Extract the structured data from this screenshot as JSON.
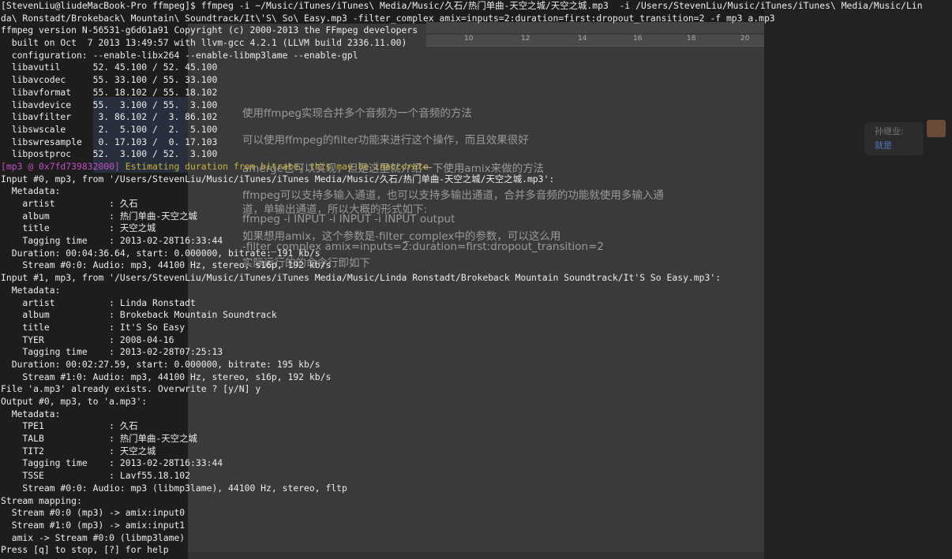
{
  "background_doc": {
    "ruler_ticks": [
      "10",
      "12",
      "14",
      "16",
      "18",
      "20"
    ],
    "lines": [
      "使用ffmpeg实现合并多个音频为一个音频的方法",
      "可以使用ffmpeg的filter功能来进行这个操作，而且效果很好",
      "amerge也可以实现，但是这里就介绍一下使用amix来做的方法",
      "ffmpeg可以支持多输入通道，也可以支持多输出通道，合并多音频的功能就使用多输入通",
      "道，单输出通道，所以大概的形式如下:",
      "ffmpeg -i INPUT -i INPUT -i INPUT output",
      "如果想用amix，这个参数是-filter_complex中的参数，可以这么用",
      "-filter_complex amix=inputs=2:duration=first:dropout_transition=2",
      "实际运行的的命令行即如下"
    ],
    "chat_name": "孙继业:",
    "chat_link": "就是"
  },
  "terminal": {
    "lines": [
      "[StevenLiu@liudeMacBook-Pro ffmpeg]$ ffmpeg -i ~/Music/iTunes/iTunes\\ Media/Music/久石/热门单曲-天空之城/天空之城.mp3  -i /Users/StevenLiu/Music/iTunes/iTunes\\ Media/Music/Lin",
      "da\\ Ronstadt/Brokeback\\ Mountain\\ Soundtrack/It\\'S\\ So\\ Easy.mp3 -filter_complex amix=inputs=2:duration=first:dropout_transition=2 -f mp3 a.mp3",
      "ffmpeg version N-56531-g6d61a91 Copyright (c) 2000-2013 the FFmpeg developers",
      "  built on Oct  7 2013 13:49:57 with llvm-gcc 4.2.1 (LLVM build 2336.11.00)",
      "  configuration: --enable-libx264 --enable-libmp3lame --enable-gpl",
      "  libavutil      52. 45.100 / 52. 45.100",
      "  libavcodec     55. 33.100 / 55. 33.100",
      "  libavformat    55. 18.102 / 55. 18.102",
      "  libavdevice    55.  3.100 / 55.  3.100",
      "  libavfilter     3. 86.102 /  3. 86.102",
      "  libswscale      2.  5.100 /  2.  5.100",
      "  libswresample   0. 17.103 /  0. 17.103",
      "  libpostproc    52.  3.100 / 52.  3.100",
      "",
      "Input #0, mp3, from '/Users/StevenLiu/Music/iTunes/iTunes Media/Music/久石/热门单曲-天空之城/天空之城.mp3':",
      "  Metadata:",
      "    artist          : 久石",
      "    album           : 热门单曲-天空之城",
      "    title           : 天空之城",
      "    Tagging time    : 2013-02-28T16:33:44",
      "  Duration: 00:04:36.64, start: 0.000000, bitrate: 191 kb/s",
      "    Stream #0:0: Audio: mp3, 44100 Hz, stereo, s16p, 192 kb/s",
      "Input #1, mp3, from '/Users/StevenLiu/Music/iTunes/iTunes Media/Music/Linda Ronstadt/Brokeback Mountain Soundtrack/It'S So Easy.mp3':",
      "  Metadata:",
      "    artist          : Linda Ronstadt",
      "    album           : Brokeback Mountain Soundtrack",
      "    title           : It'S So Easy",
      "    TYER            : 2008-04-16",
      "    Tagging time    : 2013-02-28T07:25:13",
      "  Duration: 00:02:27.59, start: 0.000000, bitrate: 195 kb/s",
      "    Stream #1:0: Audio: mp3, 44100 Hz, stereo, s16p, 192 kb/s",
      "File 'a.mp3' already exists. Overwrite ? [y/N] y",
      "Output #0, mp3, to 'a.mp3':",
      "  Metadata:",
      "    TPE1            : 久石",
      "    TALB            : 热门单曲-天空之城",
      "    TIT2            : 天空之城",
      "    Tagging time    : 2013-02-28T16:33:44",
      "    TSSE            : Lavf55.18.102",
      "    Stream #0:0: Audio: mp3 (libmp3lame), 44100 Hz, stereo, fltp",
      "Stream mapping:",
      "  Stream #0:0 (mp3) -> amix:input0",
      "  Stream #1:0 (mp3) -> amix:input1",
      "  amix -> Stream #0:0 (libmp3lame)",
      "Press [q] to stop, [?] for help"
    ],
    "warning_tag": "[mp3 @ 0x7fd739832000]",
    "warning_msg": " Estimating duration from bitrate, this may be inaccurate"
  },
  "colors": {
    "warning_tag": "#c24fc2",
    "warning_msg": "#c9b13d",
    "text": "#ececec"
  }
}
